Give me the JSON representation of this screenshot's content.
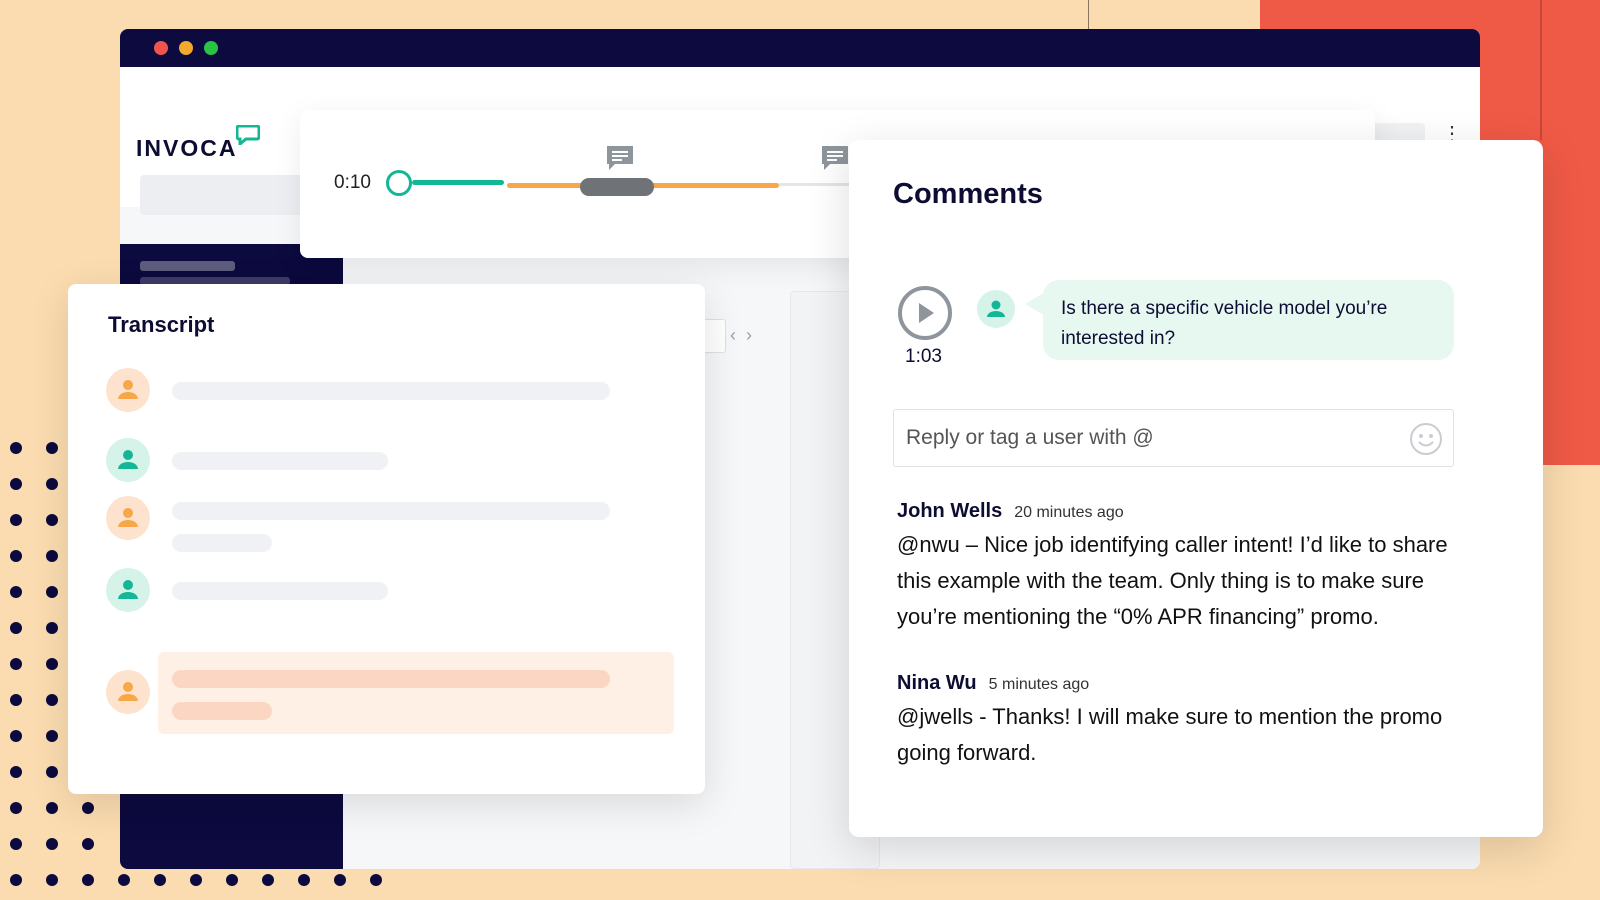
{
  "browser": {
    "traffic_lights": [
      "#f0544c",
      "#f2a92c",
      "#29c445"
    ],
    "logo_text": "INVOCA",
    "kebab": "⋮"
  },
  "colors": {
    "teal": "#13b795",
    "orange": "#f7a64a",
    "navy": "#0c0a3e",
    "background": "#fbdcb0",
    "accent_red": "#ef5a46"
  },
  "player": {
    "current_time": "0:10",
    "icons": [
      "comment-marker-icon",
      "comment-marker-icon"
    ]
  },
  "transcript": {
    "title": "Transcript",
    "rows": [
      {
        "speaker": "agent",
        "icon": "user-icon"
      },
      {
        "speaker": "caller",
        "icon": "user-icon"
      },
      {
        "speaker": "agent",
        "icon": "user-icon"
      },
      {
        "speaker": "caller",
        "icon": "user-icon"
      },
      {
        "speaker": "agent",
        "icon": "user-icon",
        "highlighted": true
      }
    ]
  },
  "comments": {
    "title": "Comments",
    "clip": {
      "timestamp": "1:03",
      "text": "Is there a specific vehicle model you’re interested in?"
    },
    "reply": {
      "placeholder": "Reply or tag a user with @",
      "emoji_icon": "smiley-icon"
    },
    "items": [
      {
        "author": "John Wells",
        "time_ago": "20 minutes ago",
        "body": "@nwu – Nice job identifying caller intent! I’d like to share this example with the team. Only thing is to make sure you’re mentioning the “0% APR financing” promo."
      },
      {
        "author": "Nina Wu",
        "time_ago": "5 minutes ago",
        "body": "@jwells - Thanks! I will make sure to mention the promo going forward."
      }
    ]
  }
}
